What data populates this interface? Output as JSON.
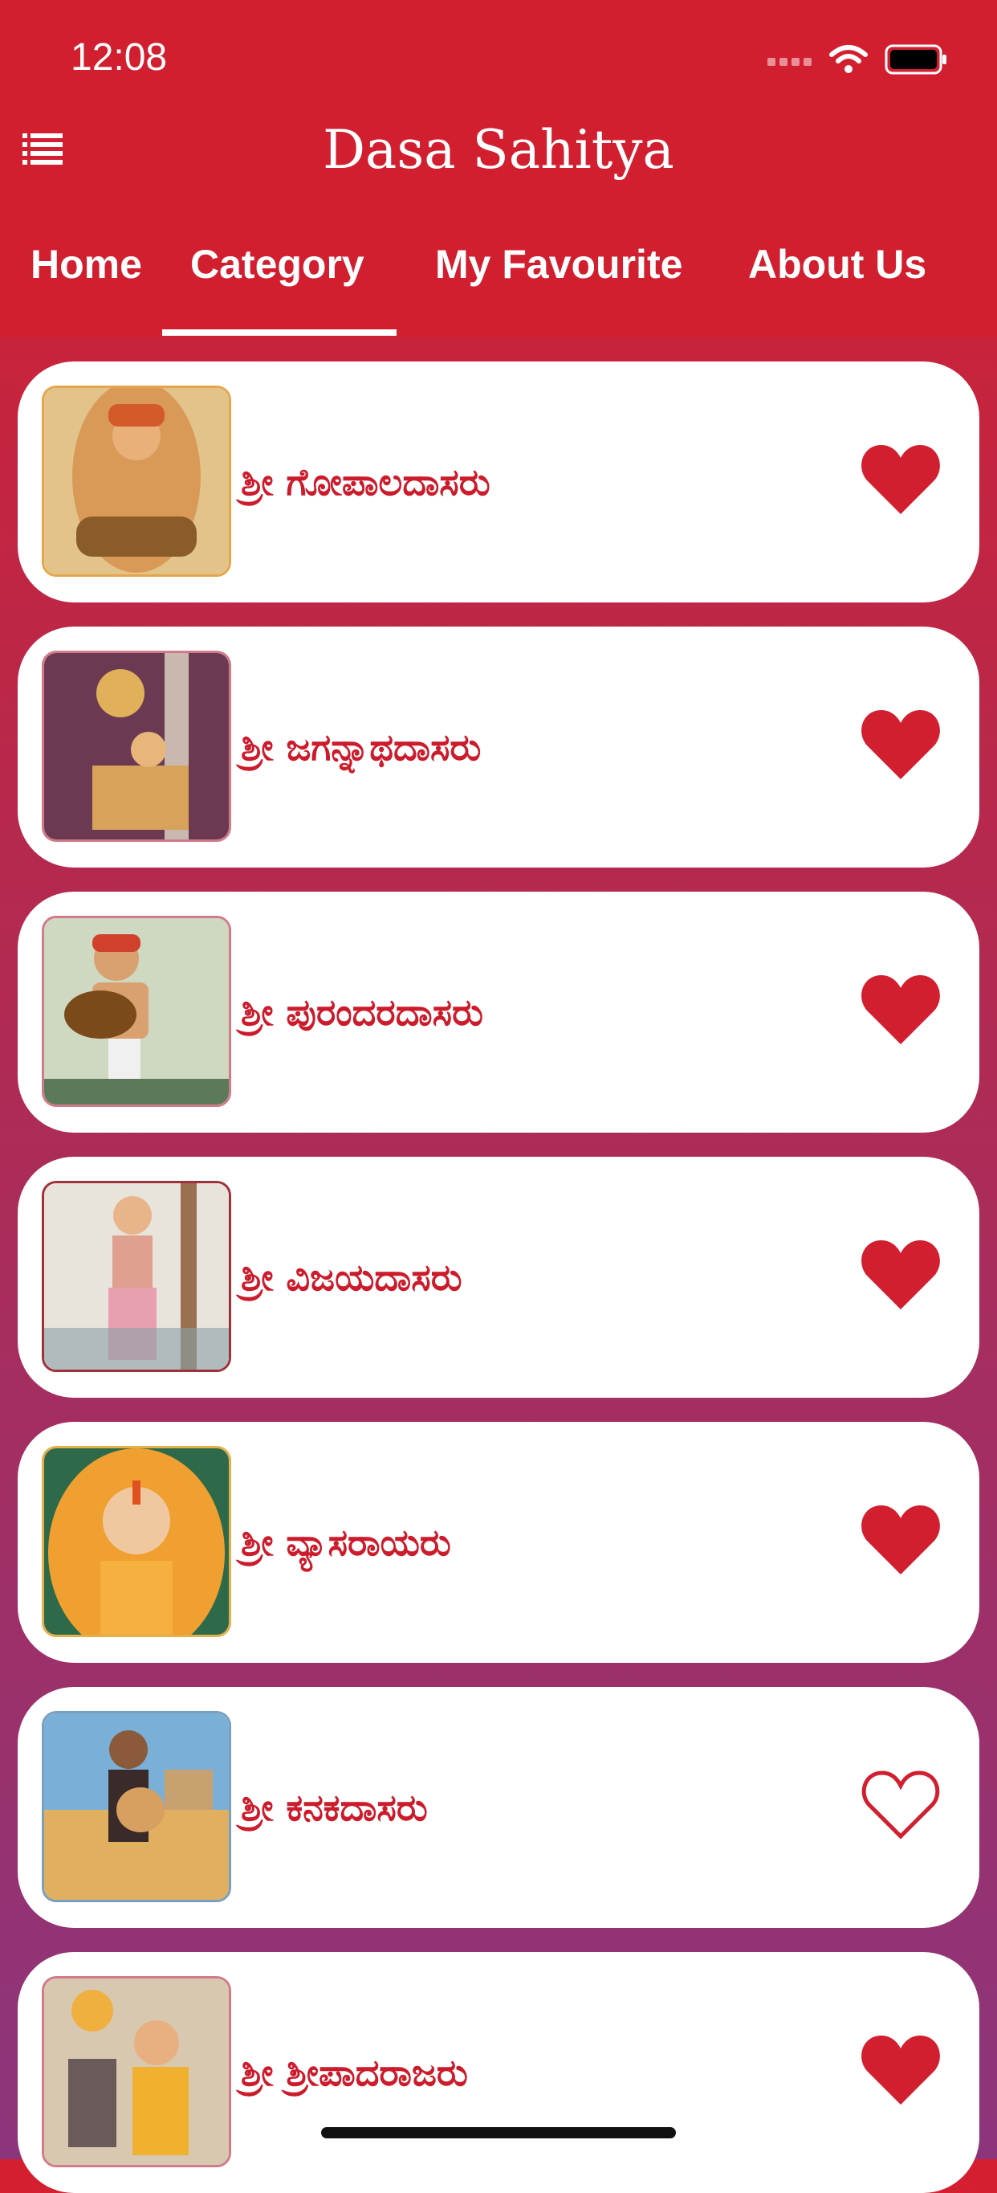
{
  "status": {
    "time": "12:08"
  },
  "app": {
    "title": "Dasa Sahitya"
  },
  "tabs": [
    {
      "label": "Home"
    },
    {
      "label": "Category"
    },
    {
      "label": "My Favourite"
    },
    {
      "label": "About Us"
    }
  ],
  "selected_tab": "Category",
  "items": [
    {
      "name": "ಶ್ರೀ ಗೋಪಾಲದಾಸರು",
      "favourite": true
    },
    {
      "name": "ಶ್ರೀ ಜಗನ್ನಾಥದಾಸರು",
      "favourite": true
    },
    {
      "name": "ಶ್ರೀ ಪುರಂದರದಾಸರು",
      "favourite": true
    },
    {
      "name": "ಶ್ರೀ ವಿಜಯದಾಸರು",
      "favourite": true
    },
    {
      "name": "ಶ್ರೀ ವ್ಯಾಸರಾಯರು",
      "favourite": true
    },
    {
      "name": "ಶ್ರೀ ಕನಕದಾಸರು",
      "favourite": false
    },
    {
      "name": "ಶ್ರೀ  ಶ್ರೀಪಾದರಾಜರು",
      "favourite": true
    }
  ],
  "colors": {
    "accent": "#d21f30",
    "text": "#cc1b2b"
  }
}
